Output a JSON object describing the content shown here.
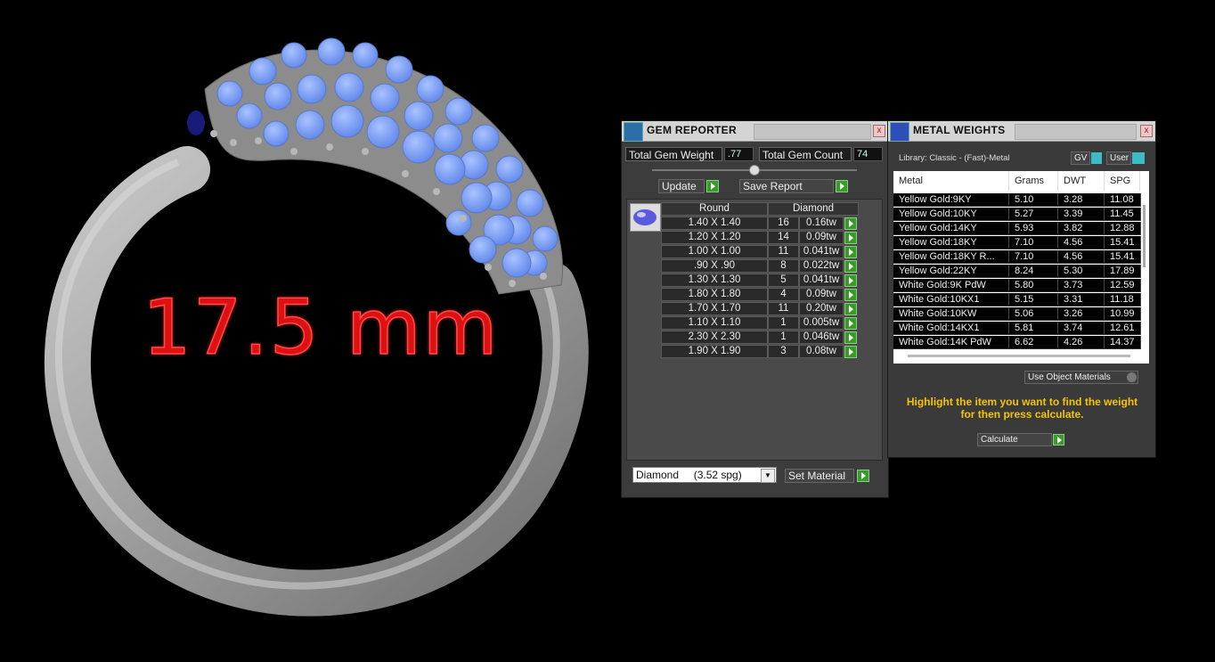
{
  "render": {
    "size_label": "17.5 mm"
  },
  "gem_reporter": {
    "title": "GEM REPORTER",
    "close": "x",
    "total_weight_label": "Total Gem Weight",
    "total_weight_value": ".77",
    "total_count_label": "Total Gem Count",
    "total_count_value": "74",
    "update_label": "Update",
    "save_report_label": "Save Report",
    "table": {
      "headers": [
        "Round",
        "Diamond"
      ],
      "rows": [
        {
          "size": "1.40 X 1.40",
          "count": "16",
          "weight": "0.16tw"
        },
        {
          "size": "1.20 X 1.20",
          "count": "14",
          "weight": "0.09tw"
        },
        {
          "size": "1.00 X 1.00",
          "count": "11",
          "weight": "0.041tw"
        },
        {
          "size": ".90 X .90",
          "count": "8",
          "weight": "0.022tw"
        },
        {
          "size": "1.30 X 1.30",
          "count": "5",
          "weight": "0.041tw"
        },
        {
          "size": "1.80 X 1.80",
          "count": "4",
          "weight": "0.09tw"
        },
        {
          "size": "1.70 X 1.70",
          "count": "11",
          "weight": "0.20tw"
        },
        {
          "size": "1.10 X 1.10",
          "count": "1",
          "weight": "0.005tw"
        },
        {
          "size": "2.30 X 2.30",
          "count": "1",
          "weight": "0.046tw"
        },
        {
          "size": "1.90 X 1.90",
          "count": "3",
          "weight": "0.08tw"
        }
      ]
    },
    "material_select": "Diamond     (3.52 spg)",
    "set_material_label": "Set Material"
  },
  "metal_weights": {
    "title": "METAL WEIGHTS",
    "close": "x",
    "library_label": "Library: Classic - (Fast)-Metal",
    "gv_label": "GV",
    "user_label": "User",
    "headers": [
      "Metal",
      "Grams",
      "DWT",
      "SPG"
    ],
    "rows": [
      {
        "metal": "Yellow Gold:9KY",
        "grams": "5.10",
        "dwt": "3.28",
        "spg": "11.08"
      },
      {
        "metal": "Yellow Gold:10KY",
        "grams": "5.27",
        "dwt": "3.39",
        "spg": "11.45"
      },
      {
        "metal": "Yellow Gold:14KY",
        "grams": "5.93",
        "dwt": "3.82",
        "spg": "12.88"
      },
      {
        "metal": "Yellow Gold:18KY",
        "grams": "7.10",
        "dwt": "4.56",
        "spg": "15.41"
      },
      {
        "metal": "Yellow Gold:18KY R...",
        "grams": "7.10",
        "dwt": "4.56",
        "spg": "15.41"
      },
      {
        "metal": "Yellow Gold:22KY",
        "grams": "8.24",
        "dwt": "5.30",
        "spg": "17.89"
      },
      {
        "metal": "White Gold:9K PdW",
        "grams": "5.80",
        "dwt": "3.73",
        "spg": "12.59"
      },
      {
        "metal": "White Gold:10KX1",
        "grams": "5.15",
        "dwt": "3.31",
        "spg": "11.18"
      },
      {
        "metal": "White Gold:10KW",
        "grams": "5.06",
        "dwt": "3.26",
        "spg": "10.99"
      },
      {
        "metal": "White Gold:14KX1",
        "grams": "5.81",
        "dwt": "3.74",
        "spg": "12.61"
      },
      {
        "metal": "White Gold:14K PdW",
        "grams": "6.62",
        "dwt": "4.26",
        "spg": "14.37"
      }
    ],
    "use_object_materials_label": "Use Object Materials",
    "hint": "Highlight the item you want to find the weight for then press calculate.",
    "calculate_label": "Calculate"
  },
  "colors": {
    "gem_blue": "#7fa6ff",
    "metal_gray": "#a9a9a9",
    "label_red": "#e01818",
    "hint_yellow": "#f5c400",
    "go_green": "#3a9a2a"
  }
}
